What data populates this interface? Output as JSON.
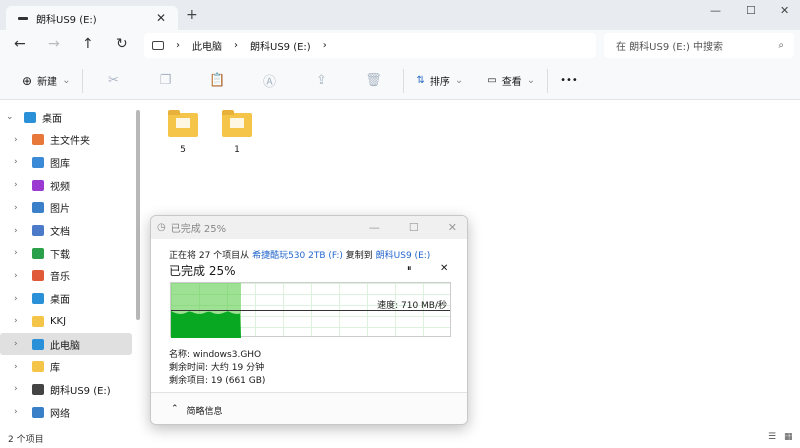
{
  "window": {
    "tab_title": "朗科US9 (E:)",
    "new_tab": "+",
    "close": "✕",
    "min": "—",
    "max": "☐",
    "winclose": "✕"
  },
  "address": {
    "crumbs": [
      "此电脑",
      "朗科US9 (E:)"
    ],
    "search_placeholder": "在 朗科US9 (E:) 中搜索"
  },
  "toolbar": {
    "new": "新建",
    "sort": "排序",
    "view": "查看",
    "more": "•••"
  },
  "sidebar": {
    "items": [
      {
        "label": "桌面",
        "chev": "⌄",
        "color": "#2a90d8",
        "sel": false,
        "lvl": 0
      },
      {
        "label": "主文件夹",
        "color": "#e8773a"
      },
      {
        "label": "图库",
        "color": "#3a8ad8"
      },
      {
        "label": "视频",
        "color": "#9a3ad0"
      },
      {
        "label": "图片",
        "color": "#3a80c8"
      },
      {
        "label": "文档",
        "color": "#4a7ac8"
      },
      {
        "label": "下载",
        "color": "#2aa04a"
      },
      {
        "label": "音乐",
        "color": "#e05a3a"
      },
      {
        "label": "桌面",
        "color": "#2a90d8"
      },
      {
        "label": "KKJ",
        "color": "#f5c54a"
      },
      {
        "label": "此电脑",
        "color": "#2a90d8"
      },
      {
        "label": "库",
        "color": "#f5c54a"
      },
      {
        "label": "朗科US9 (E:)",
        "color": "#444"
      },
      {
        "label": "网络",
        "color": "#3a80c8"
      }
    ]
  },
  "files": [
    {
      "name": "5"
    },
    {
      "name": "1"
    }
  ],
  "status": "2 个项目",
  "dialog": {
    "title": "已完成 25%",
    "line1_prefix": "正在将 27 个项目从",
    "source": "希捷酷玩530 2TB (F:)",
    "line1_mid": "复制到",
    "dest": "朗科US9 (E:)",
    "progress_label": "已完成 25%",
    "progress": 0.25,
    "speed": "速度: 710 MB/秒",
    "name": "名称: windows3.GHO",
    "time_left": "剩余时间: 大约 19 分钟",
    "items_left": "剩余项目: 19 (661 GB)",
    "details_toggle": "简略信息",
    "pause": "⏸",
    "cancel": "✕"
  }
}
